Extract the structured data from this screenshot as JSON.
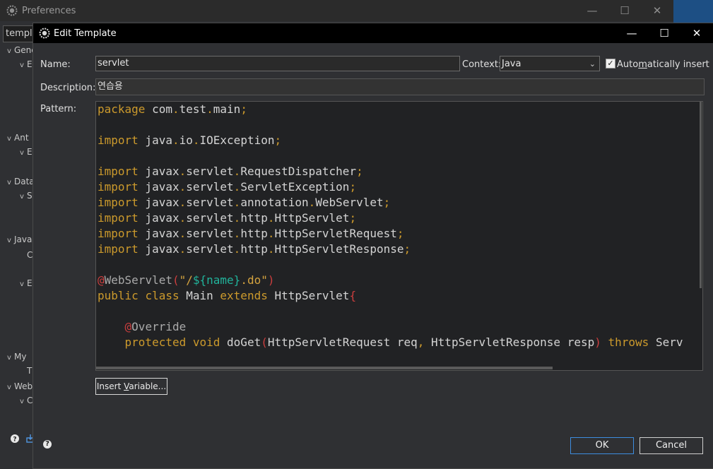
{
  "preferences": {
    "title": "Preferences",
    "filter_text": "template",
    "tree": [
      {
        "label": "General",
        "chev": "v"
      },
      {
        "label": "E",
        "chev": "v"
      },
      {
        "label": "Ant",
        "chev": "v"
      },
      {
        "label": "E",
        "chev": "v"
      },
      {
        "label": "Data",
        "chev": "v"
      },
      {
        "label": "S",
        "chev": "v"
      },
      {
        "label": "Java",
        "chev": "v"
      },
      {
        "label": "C",
        "chev": ""
      },
      {
        "label": "E",
        "chev": "v"
      },
      {
        "label": "My",
        "chev": "v"
      },
      {
        "label": "T",
        "chev": ""
      },
      {
        "label": "Web",
        "chev": "v"
      },
      {
        "label": "C",
        "chev": "v"
      }
    ]
  },
  "dialog": {
    "title": "Edit Template",
    "name_label": "Name:",
    "name_value": "servlet",
    "context_label": "Context:",
    "context_value": "Java",
    "auto_insert_pre": "Auto",
    "auto_insert_ul": "m",
    "auto_insert_post": "atically insert",
    "auto_insert_checked": true,
    "description_label": "Description:",
    "description_value": "연습용",
    "pattern_label": "Pattern:",
    "insert_variable_pre": "Insert ",
    "insert_variable_ul": "V",
    "insert_variable_post": "ariable...",
    "ok_label": "OK",
    "cancel_label": "Cancel"
  },
  "code_lines": [
    "package com.test.main;",
    "",
    "import java.io.IOException;",
    "",
    "import javax.servlet.RequestDispatcher;",
    "import javax.servlet.ServletException;",
    "import javax.servlet.annotation.WebServlet;",
    "import javax.servlet.http.HttpServlet;",
    "import javax.servlet.http.HttpServletRequest;",
    "import javax.servlet.http.HttpServletResponse;",
    "",
    "@WebServlet(\"/${name}.do\")",
    "public class Main extends HttpServlet{",
    "",
    "    @Override",
    "    protected void doGet(HttpServletRequest req, HttpServletResponse resp) throws Serv"
  ],
  "colors": {
    "keyword": "#cc9a2c",
    "variable": "#21b39b",
    "paren": "#cc3e3e",
    "accent_button": "#3d8ee0"
  }
}
